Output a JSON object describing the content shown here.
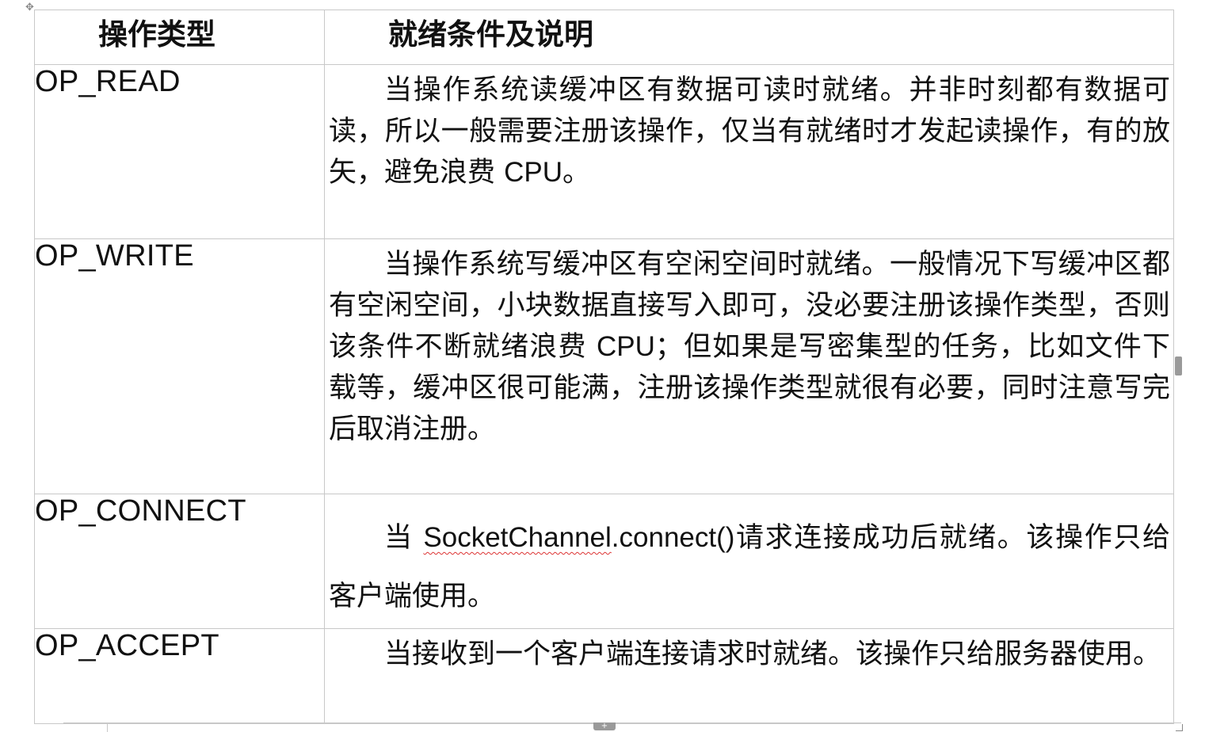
{
  "table": {
    "headers": [
      "操作类型",
      "就绪条件及说明"
    ],
    "rows": [
      {
        "op": "OP_READ",
        "desc_a": "当操作系统读缓冲区有数据可读时就绪。并非时刻都有数据可读，所以一般需要注册该操作，仅当有就绪时才发起读操作，有的放矢，避免浪费 ",
        "desc_cpu": "CPU",
        "desc_b": "。"
      },
      {
        "op": "OP_WRITE",
        "desc_a": "当操作系统写缓冲区有空闲空间时就绪。一般情况下写缓冲区都有空闲空间，小块数据直接写入即可，没必要注册该操作类型，否则该条件不断就绪浪费 ",
        "desc_cpu": "CPU",
        "desc_b": "；但如果是写密集型的任务，比如文件下载等，缓冲区很可能满，注册该操作类型就很有必要，同时注意写完后取消注册。"
      },
      {
        "op": "OP_CONNECT",
        "desc_pre": "当 ",
        "desc_code": "SocketChannel",
        "desc_code2": ".connect()",
        "desc_post": "请求连接成功后就绪。该操作只给客户端使用。"
      },
      {
        "op": "OP_ACCEPT",
        "desc": "当接收到一个客户端连接请求时就绪。该操作只给服务器使用。"
      }
    ]
  }
}
